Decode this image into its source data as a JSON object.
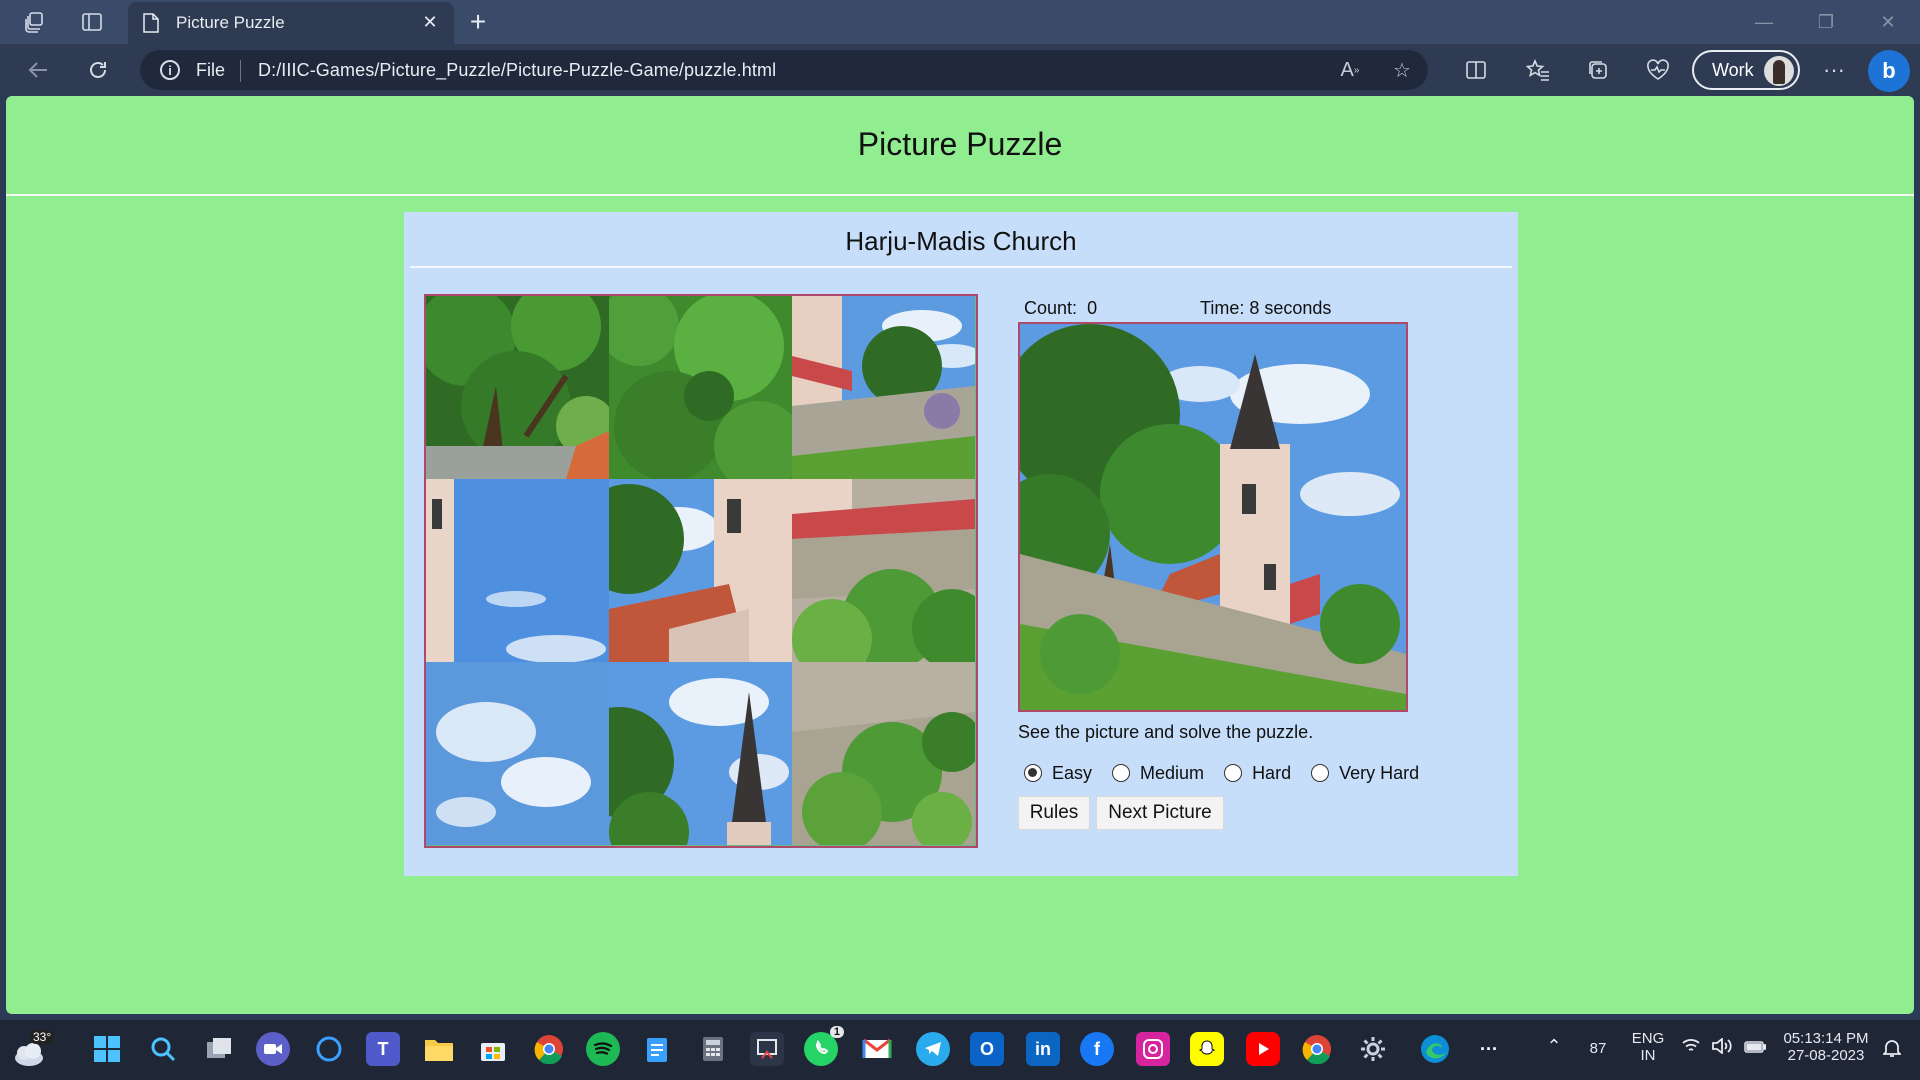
{
  "browser": {
    "tab_title": "Picture Puzzle",
    "address": {
      "scheme_label": "File",
      "url": "D:/IIIC-Games/Picture_Puzzle/Picture-Puzzle-Game/puzzle.html"
    },
    "profile_label": "Work",
    "icons": [
      "workspaces-icon",
      "tab-actions-icon",
      "page-icon",
      "close-icon",
      "new-tab-icon",
      "back-icon",
      "refresh-icon",
      "info-icon",
      "read-aloud-icon",
      "favorite-star-icon",
      "split-screen-icon",
      "favorites-icon",
      "collections-icon",
      "browser-essentials-icon",
      "more-icon",
      "copilot-icon"
    ]
  },
  "page": {
    "title": "Picture Puzzle",
    "puzzle": {
      "picture_name": "Harju-Madis Church",
      "count_label": "Count:",
      "count_value": "0",
      "time_label": "Time: 8 seconds",
      "hint": "See the picture and solve the puzzle.",
      "levels": [
        {
          "label": "Easy",
          "checked": true
        },
        {
          "label": "Medium",
          "checked": false
        },
        {
          "label": "Hard",
          "checked": false
        },
        {
          "label": "Very Hard",
          "checked": false
        }
      ],
      "buttons": {
        "rules": "Rules",
        "next": "Next Picture"
      }
    }
  },
  "taskbar": {
    "weather_temp": "33°",
    "tray": {
      "battery": "87",
      "lang_line1": "ENG",
      "lang_line2": "IN",
      "time": "05:13:14 PM",
      "date": "27-08-2023"
    },
    "whatsapp_badge": "1"
  }
}
